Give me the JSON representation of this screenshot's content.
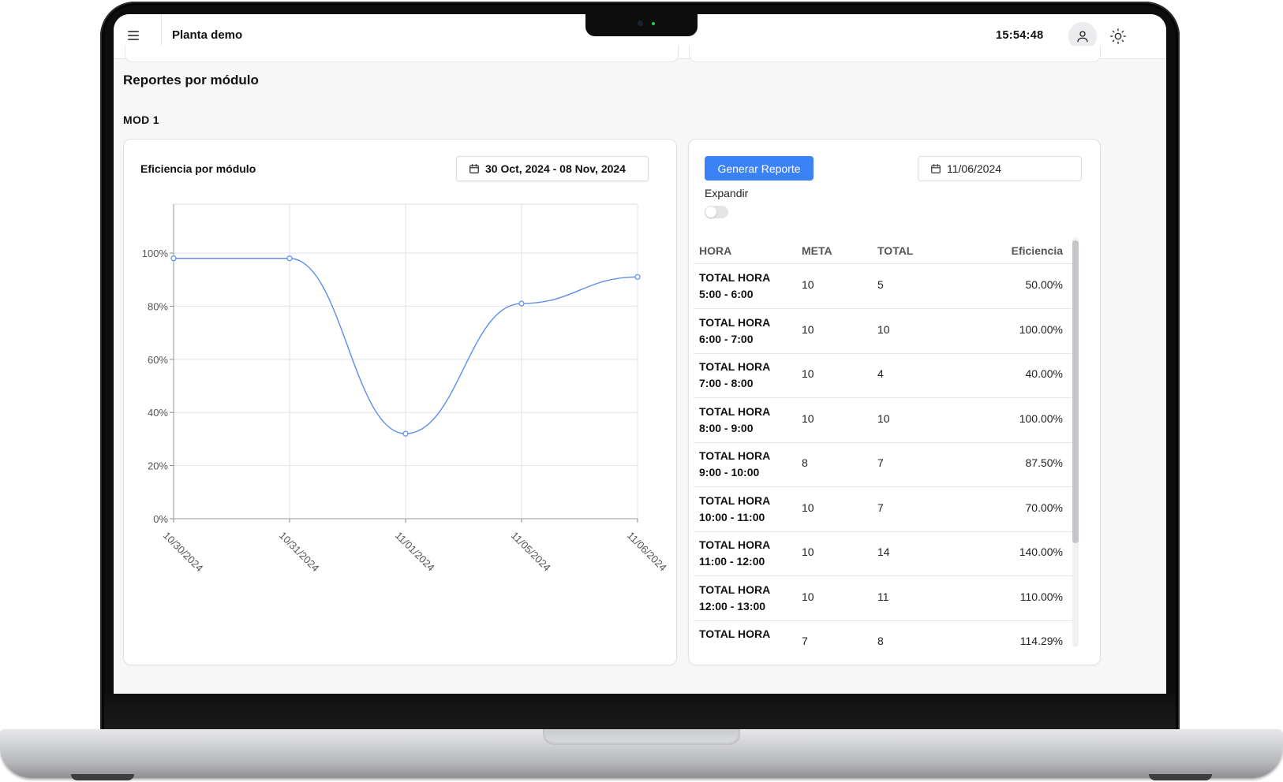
{
  "header": {
    "plant_title": "Planta demo",
    "clock": "15:54:48"
  },
  "section": {
    "title": "Reportes por módulo",
    "module": "MOD 1"
  },
  "chart_card": {
    "title": "Eficiencia por módulo",
    "date_range": "30 Oct, 2024 - 08 Nov, 2024"
  },
  "chart_data": {
    "type": "line",
    "title": "",
    "xlabel": "",
    "ylabel": "",
    "x": [
      "10/30/2024",
      "10/31/2024",
      "11/01/2024",
      "11/05/2024",
      "11/06/2024"
    ],
    "series": [
      {
        "values": [
          98,
          98,
          32,
          81,
          91
        ]
      }
    ],
    "ylim": [
      0,
      100
    ],
    "yticks": [
      "0%",
      "20%",
      "40%",
      "60%",
      "80%",
      "100%"
    ],
    "y_tick_values": [
      0,
      20,
      40,
      60,
      80,
      100
    ],
    "grid": true,
    "line_color": "#5b8def"
  },
  "report_panel": {
    "generate_label": "Generar Reporte",
    "date": "11/06/2024",
    "expand_label": "Expandir",
    "expand_on": false,
    "columns": [
      "HORA",
      "META",
      "TOTAL",
      "Eficiencia"
    ],
    "rows": [
      {
        "hora_l1": "TOTAL HORA",
        "hora_l2": "5:00 - 6:00",
        "meta": "10",
        "total": "5",
        "eficiencia": "50.00%"
      },
      {
        "hora_l1": "TOTAL HORA",
        "hora_l2": "6:00 - 7:00",
        "meta": "10",
        "total": "10",
        "eficiencia": "100.00%"
      },
      {
        "hora_l1": "TOTAL HORA",
        "hora_l2": "7:00 - 8:00",
        "meta": "10",
        "total": "4",
        "eficiencia": "40.00%"
      },
      {
        "hora_l1": "TOTAL HORA",
        "hora_l2": "8:00 - 9:00",
        "meta": "10",
        "total": "10",
        "eficiencia": "100.00%"
      },
      {
        "hora_l1": "TOTAL HORA",
        "hora_l2": "9:00 - 10:00",
        "meta": "8",
        "total": "7",
        "eficiencia": "87.50%"
      },
      {
        "hora_l1": "TOTAL HORA",
        "hora_l2": "10:00 - 11:00",
        "meta": "10",
        "total": "7",
        "eficiencia": "70.00%"
      },
      {
        "hora_l1": "TOTAL HORA",
        "hora_l2": "11:00 - 12:00",
        "meta": "10",
        "total": "14",
        "eficiencia": "140.00%"
      },
      {
        "hora_l1": "TOTAL HORA",
        "hora_l2": "12:00 - 13:00",
        "meta": "10",
        "total": "11",
        "eficiencia": "110.00%"
      },
      {
        "hora_l1": "TOTAL HORA",
        "hora_l2": "",
        "meta": "7",
        "total": "8",
        "eficiencia": "114.29%"
      }
    ]
  },
  "colors": {
    "primary": "#3b82f6",
    "background": "#f7f7f8"
  },
  "icons": {
    "menu": "menu-icon",
    "user": "user-icon",
    "theme": "sun-icon",
    "calendar": "calendar-icon"
  }
}
